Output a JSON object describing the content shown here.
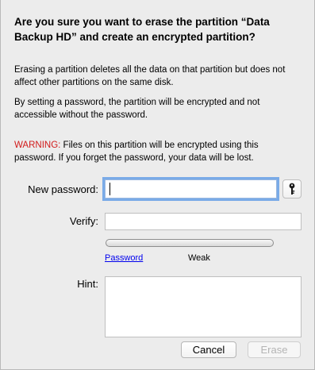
{
  "dialog": {
    "title": "Are you sure you want to erase the partition “Data Backup HD” and create an encrypted partition?",
    "paragraph_1": "Erasing a partition deletes all the data on that partition but does not affect other partitions on the same disk.",
    "paragraph_2": "By setting a password, the partition will be encrypted and not accessible without the password.",
    "warning_label": "WARNING:",
    "warning_text": " Files on this partition will be encrypted using this password. If you forget the password, your data will be lost.",
    "warning_color": "#d11a1a"
  },
  "form": {
    "new_password_label": "New password:",
    "new_password_value": "",
    "verify_label": "Verify:",
    "verify_value": "",
    "hint_label": "Hint:",
    "hint_value": "",
    "key_icon": "key-icon",
    "password_link": "Password",
    "strength_text": "Weak",
    "strength_level": 0
  },
  "buttons": {
    "cancel": "Cancel",
    "erase": "Erase"
  },
  "colors": {
    "focus_ring": "#7aabe8",
    "link": "#0000ee"
  }
}
